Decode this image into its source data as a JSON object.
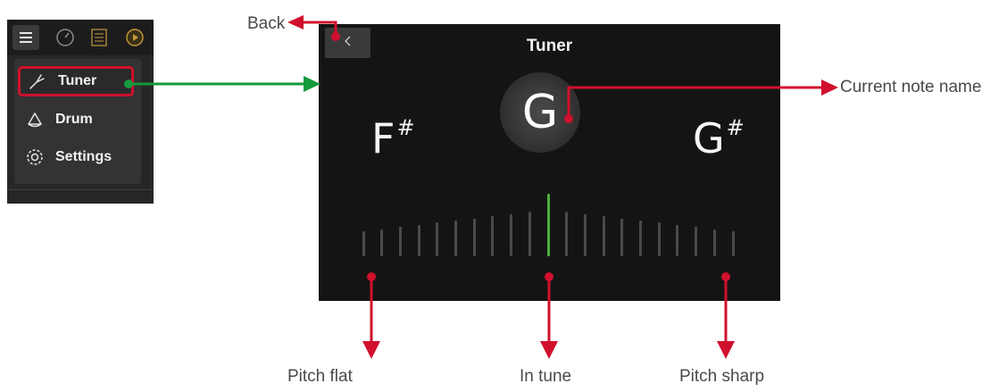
{
  "menu": {
    "items": [
      {
        "label": "Tuner",
        "icon": "tuning-fork-icon",
        "active": true
      },
      {
        "label": "Drum",
        "icon": "drum-icon",
        "active": false
      },
      {
        "label": "Settings",
        "icon": "gear-icon",
        "active": false
      }
    ],
    "toolbar_icons": [
      "hamburger-icon",
      "gauge-icon",
      "list-icon",
      "play-icon"
    ]
  },
  "tuner": {
    "title": "Tuner",
    "note_flat": {
      "letter": "F",
      "accidental": "#"
    },
    "note_current": "G",
    "note_sharp": {
      "letter": "G",
      "accidental": "#"
    },
    "meter_ticks": 21,
    "meter_active_index": 10
  },
  "annotations": {
    "back": "Back",
    "current_note": "Current note name",
    "pitch_flat": "Pitch flat",
    "in_tune": "In tune",
    "pitch_sharp": "Pitch sharp"
  },
  "colors": {
    "accent_red": "#d0102c",
    "arrow_green": "#129a3c",
    "in_tune_green": "#4caf3c",
    "screen_bg": "#141414"
  }
}
